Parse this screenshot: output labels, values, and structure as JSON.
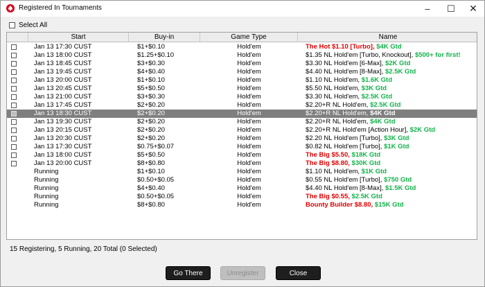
{
  "window": {
    "title": "Registered In Tournaments",
    "icon": "pokerstars-spade-icon",
    "controls": {
      "minimize": "–",
      "maximize": "☐",
      "close": "✕"
    }
  },
  "select_all": {
    "label": "Select All",
    "checked": false
  },
  "table": {
    "columns": [
      "",
      "Start",
      "Buy-in",
      "Game Type",
      "Name"
    ],
    "rows": [
      {
        "checkbox": true,
        "start": "Jan 13  17:30 CUST",
        "buyin": "$1+$0.10",
        "game": "Hold'em",
        "name": [
          {
            "t": "The Hot $1.10 [Turbo], ",
            "c": "red"
          },
          {
            "t": "$4K Gtd",
            "c": "green"
          }
        ]
      },
      {
        "checkbox": true,
        "start": "Jan 13  18:00 CUST",
        "buyin": "$1.25+$0.10",
        "game": "Hold'em",
        "name": [
          {
            "t": "$1.35 NL Hold'em [Turbo, Knockout], ",
            "c": "black"
          },
          {
            "t": "$500+ for first!",
            "c": "green"
          }
        ]
      },
      {
        "checkbox": true,
        "start": "Jan 13  18:45 CUST",
        "buyin": "$3+$0.30",
        "game": "Hold'em",
        "name": [
          {
            "t": "$3.30 NL Hold'em [6-Max], ",
            "c": "black"
          },
          {
            "t": "$2K Gtd",
            "c": "green"
          }
        ]
      },
      {
        "checkbox": true,
        "start": "Jan 13  19:45 CUST",
        "buyin": "$4+$0.40",
        "game": "Hold'em",
        "name": [
          {
            "t": "$4.40 NL Hold'em [8-Max], ",
            "c": "black"
          },
          {
            "t": "$2.5K Gtd",
            "c": "green"
          }
        ]
      },
      {
        "checkbox": true,
        "start": "Jan 13  20:00 CUST",
        "buyin": "$1+$0.10",
        "game": "Hold'em",
        "name": [
          {
            "t": "$1.10 NL Hold'em, ",
            "c": "black"
          },
          {
            "t": "$1.6K Gtd",
            "c": "green"
          }
        ]
      },
      {
        "checkbox": true,
        "start": "Jan 13  20:45 CUST",
        "buyin": "$5+$0.50",
        "game": "Hold'em",
        "name": [
          {
            "t": "$5.50 NL Hold'em, ",
            "c": "black"
          },
          {
            "t": "$3K Gtd",
            "c": "green"
          }
        ]
      },
      {
        "checkbox": true,
        "start": "Jan 13  21:00 CUST",
        "buyin": "$3+$0.30",
        "game": "Hold'em",
        "name": [
          {
            "t": "$3.30 NL Hold'em, ",
            "c": "black"
          },
          {
            "t": "$2.5K Gtd",
            "c": "green"
          }
        ]
      },
      {
        "checkbox": true,
        "start": "Jan 13  17:45 CUST",
        "buyin": "$2+$0.20",
        "game": "Hold'em",
        "name": [
          {
            "t": "$2.20+R NL Hold'em, ",
            "c": "black"
          },
          {
            "t": "$2.5K Gtd",
            "c": "green"
          }
        ]
      },
      {
        "checkbox": true,
        "selected": true,
        "start": "Jan 13  18:30 CUST",
        "buyin": "$2+$0.20",
        "game": "Hold'em",
        "name": [
          {
            "t": "$2.20+R NL Hold'em, ",
            "c": "black"
          },
          {
            "t": "$4K Gtd",
            "c": "green"
          }
        ]
      },
      {
        "checkbox": true,
        "start": "Jan 13  19:30 CUST",
        "buyin": "$2+$0.20",
        "game": "Hold'em",
        "name": [
          {
            "t": "$2.20+R NL Hold'em, ",
            "c": "black"
          },
          {
            "t": "$4K Gtd",
            "c": "green"
          }
        ]
      },
      {
        "checkbox": true,
        "start": "Jan 13  20:15 CUST",
        "buyin": "$2+$0.20",
        "game": "Hold'em",
        "name": [
          {
            "t": "$2.20+R NL Hold'em [Action Hour], ",
            "c": "black"
          },
          {
            "t": "$2K Gtd",
            "c": "green"
          }
        ]
      },
      {
        "checkbox": true,
        "start": "Jan 13  20:30 CUST",
        "buyin": "$2+$0.20",
        "game": "Hold'em",
        "name": [
          {
            "t": "$2.20 NL Hold'em [Turbo], ",
            "c": "black"
          },
          {
            "t": "$3K Gtd",
            "c": "green"
          }
        ]
      },
      {
        "checkbox": true,
        "start": "Jan 13  17:30 CUST",
        "buyin": "$0.75+$0.07",
        "game": "Hold'em",
        "name": [
          {
            "t": "$0.82 NL Hold'em [Turbo], ",
            "c": "black"
          },
          {
            "t": "$1K Gtd",
            "c": "green"
          }
        ]
      },
      {
        "checkbox": true,
        "start": "Jan 13  18:00 CUST",
        "buyin": "$5+$0.50",
        "game": "Hold'em",
        "name": [
          {
            "t": "The Big $5.50, ",
            "c": "red"
          },
          {
            "t": "$18K Gtd",
            "c": "green"
          }
        ]
      },
      {
        "checkbox": true,
        "start": "Jan 13  20:00 CUST",
        "buyin": "$8+$0.80",
        "game": "Hold'em",
        "name": [
          {
            "t": "The Big $8.80, ",
            "c": "red"
          },
          {
            "t": "$30K Gtd",
            "c": "green"
          }
        ]
      },
      {
        "checkbox": false,
        "start": "Running",
        "buyin": "$1+$0.10",
        "game": "Hold'em",
        "name": [
          {
            "t": "$1.10 NL Hold'em, ",
            "c": "black"
          },
          {
            "t": "$1K Gtd",
            "c": "green"
          }
        ]
      },
      {
        "checkbox": false,
        "start": "Running",
        "buyin": "$0.50+$0.05",
        "game": "Hold'em",
        "name": [
          {
            "t": "$0.55 NL Hold'em [Turbo], ",
            "c": "black"
          },
          {
            "t": "$750 Gtd",
            "c": "green"
          }
        ]
      },
      {
        "checkbox": false,
        "start": "Running",
        "buyin": "$4+$0.40",
        "game": "Hold'em",
        "name": [
          {
            "t": "$4.40 NL Hold'em [8-Max], ",
            "c": "black"
          },
          {
            "t": "$1.5K Gtd",
            "c": "green"
          }
        ]
      },
      {
        "checkbox": false,
        "start": "Running",
        "buyin": "$0.50+$0.05",
        "game": "Hold'em",
        "name": [
          {
            "t": "The Big $0.55, ",
            "c": "red"
          },
          {
            "t": "$2.5K Gtd",
            "c": "green"
          }
        ]
      },
      {
        "checkbox": false,
        "start": "Running",
        "buyin": "$8+$0.80",
        "game": "Hold'em",
        "name": [
          {
            "t": "Bounty Builder $8.80, ",
            "c": "red"
          },
          {
            "t": "$15K Gtd",
            "c": "green"
          }
        ]
      }
    ]
  },
  "status": "15 Registering, 5 Running, 20 Total (0 Selected)",
  "buttons": {
    "go_there": "Go There",
    "unregister": "Unregister",
    "close": "Close"
  },
  "colors": {
    "red_name": "#e00000",
    "green_gtd": "#13b24a",
    "selected_row": "#7f7f7f"
  }
}
